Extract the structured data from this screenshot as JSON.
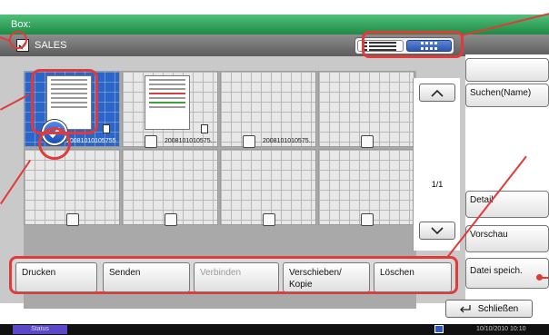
{
  "window": {
    "title": "Box:"
  },
  "folder": {
    "name": "SALES"
  },
  "files": [
    {
      "name": "20081010105755",
      "selected": true
    },
    {
      "name": "2008101010575...",
      "selected": false
    },
    {
      "name": "2008101010575...",
      "selected": false
    }
  ],
  "page": {
    "indicator": "1/1"
  },
  "side_buttons": {
    "search_name": "Suchen(Name)",
    "detail": "Detail",
    "preview": "Vorschau",
    "save_file": "Datei speich."
  },
  "bottom_buttons": {
    "print": "Drucken",
    "send": "Senden",
    "join": "Verbinden",
    "move_copy": "Verschieben/\nKopie",
    "delete": "Löschen"
  },
  "close": {
    "label": "Schließen"
  },
  "status": {
    "label": "Status",
    "datetime": "10/10/2010  10:10"
  },
  "icons": {
    "list_view": "list-view-icon",
    "thumbnail_view": "thumbnail-view-icon",
    "up": "chevron-up-icon",
    "down": "chevron-down-icon",
    "check": "check-icon",
    "close": "return-arrow-icon"
  },
  "colors": {
    "accent_red": "#e03a3a",
    "title_green": "#2fa85a",
    "selection_blue": "#2c65c8"
  }
}
